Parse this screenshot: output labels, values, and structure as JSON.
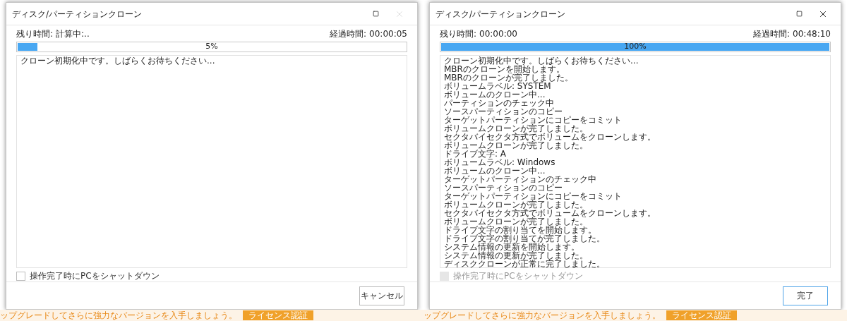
{
  "panes": [
    {
      "dialog": {
        "title": "ディスク/パーティションクローン",
        "close_disabled": true,
        "remaining_label": "残り時間:",
        "remaining_value": "計算中:..",
        "elapsed_label": "経過時間:",
        "elapsed_value": "00:00:05",
        "progress": {
          "level": 0.05,
          "text": "5%"
        },
        "log": [
          "クローン初期化中です。しばらくお待ちください..."
        ],
        "shutdown": {
          "label": "操作完了時にPCをシャットダウン",
          "checked": false,
          "disabled": false
        },
        "button": {
          "label": "キャンセル",
          "focused": false
        }
      },
      "banner": {
        "text": "ップグレードしてさらに強力なバージョンを入手しましょう。",
        "button": "ライセンス認証"
      }
    },
    {
      "dialog": {
        "title": "ディスク/パーティションクローン",
        "close_disabled": false,
        "remaining_label": "残り時間:",
        "remaining_value": "00:00:00",
        "elapsed_label": "経過時間:",
        "elapsed_value": "00:48:10",
        "progress": {
          "level": 1,
          "text": "100%"
        },
        "log": [
          "クローン初期化中です。しばらくお待ちください...",
          "MBRのクローンを開始します。",
          "MBRのクローンが完了しました。",
          "ボリュームラベル: SYSTEM",
          "ボリュームのクローン中...",
          "パーティションのチェック中",
          "ソースパーティションのコピー",
          "ターゲットパーティションにコピーをコミット",
          "ボリュームクローンが完了しました。",
          "セクタバイセクタ方式でボリュームをクローンします。",
          "ボリュームクローンが完了しました。",
          "ドライブ文字: A",
          "ボリュームラベル: Windows",
          "ボリュームのクローン中...",
          "ターゲットパーティションのチェック中",
          "ソースパーティションのコピー",
          "ターゲットパーティションにコピーをコミット",
          "ボリュームクローンが完了しました。",
          "セクタバイセクタ方式でボリュームをクローンします。",
          "ボリュームクローンが完了しました。",
          "ドライブ文字の割り当てを開始します。",
          "ドライブ文字の割り当てが完了しました。",
          "システム情報の更新を開始します。",
          "システム情報の更新が完了しました。",
          "ディスククローンが正常に完了しました。"
        ],
        "shutdown": {
          "label": "操作完了時にPCをシャットダウン",
          "checked": false,
          "disabled": true
        },
        "button": {
          "label": "完了",
          "focused": true
        }
      },
      "banner": {
        "text": "ップグレードしてさらに強力なバージョンを入手しましょう。",
        "button": "ライセンス認証"
      }
    }
  ]
}
